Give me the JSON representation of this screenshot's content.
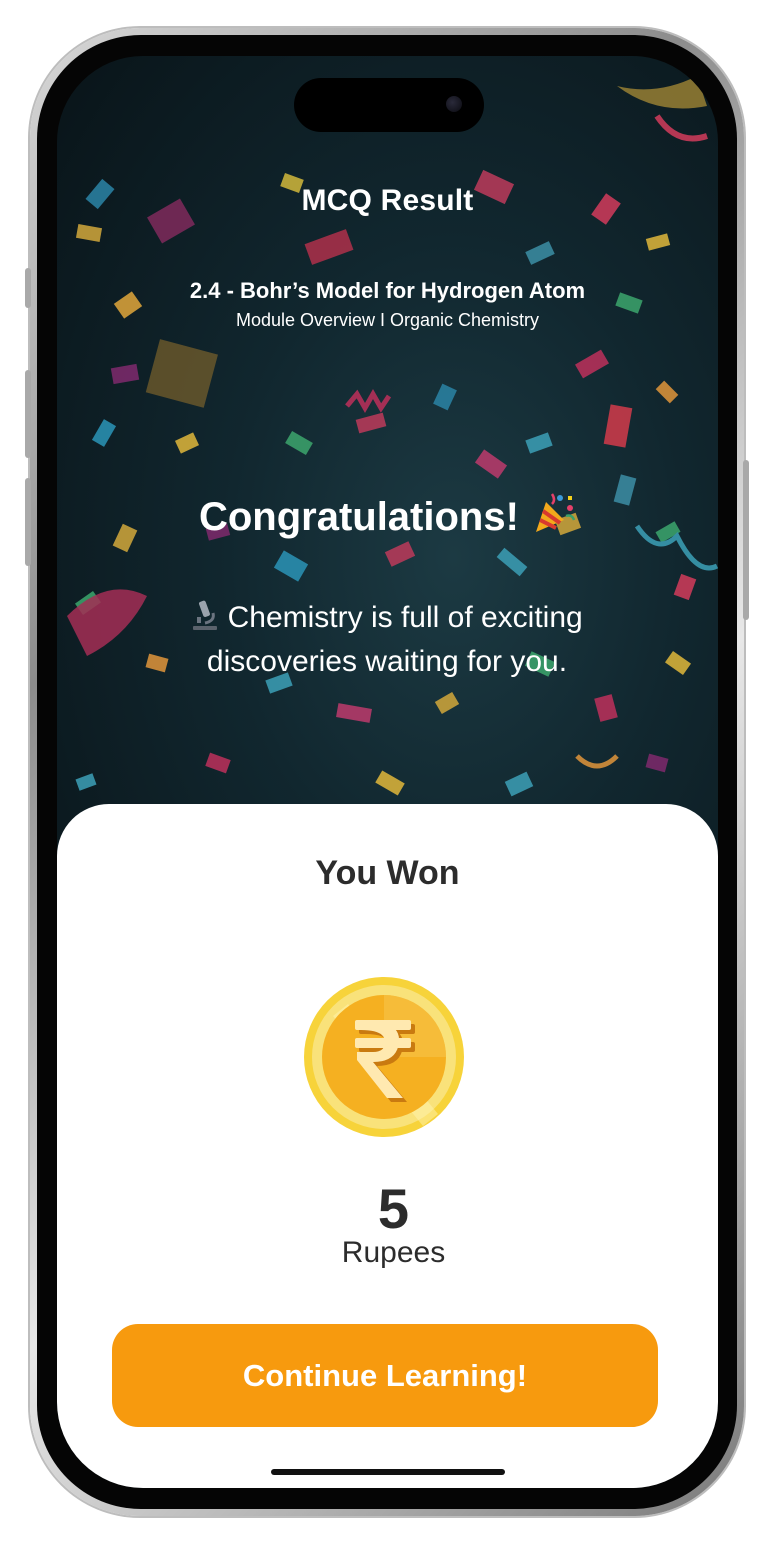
{
  "header": {
    "title": "MCQ Result",
    "lesson": "2.4 - Bohr’s Model for Hydrogen Atom",
    "module": "Module Overview I Organic Chemistry"
  },
  "celebration": {
    "heading": "Congratulations!",
    "heading_icon": "party-popper-icon",
    "message_icon": "microscope-icon",
    "message": "Chemistry is full of exciting discoveries waiting for you."
  },
  "reward": {
    "label": "You Won",
    "coin_icon": "rupee-coin-icon",
    "amount": "5",
    "unit": "Rupees"
  },
  "actions": {
    "continue_label": "Continue Learning!"
  },
  "colors": {
    "accent": "#f79a0e",
    "background": "#12272e",
    "coin_gold": "#f5b021"
  }
}
